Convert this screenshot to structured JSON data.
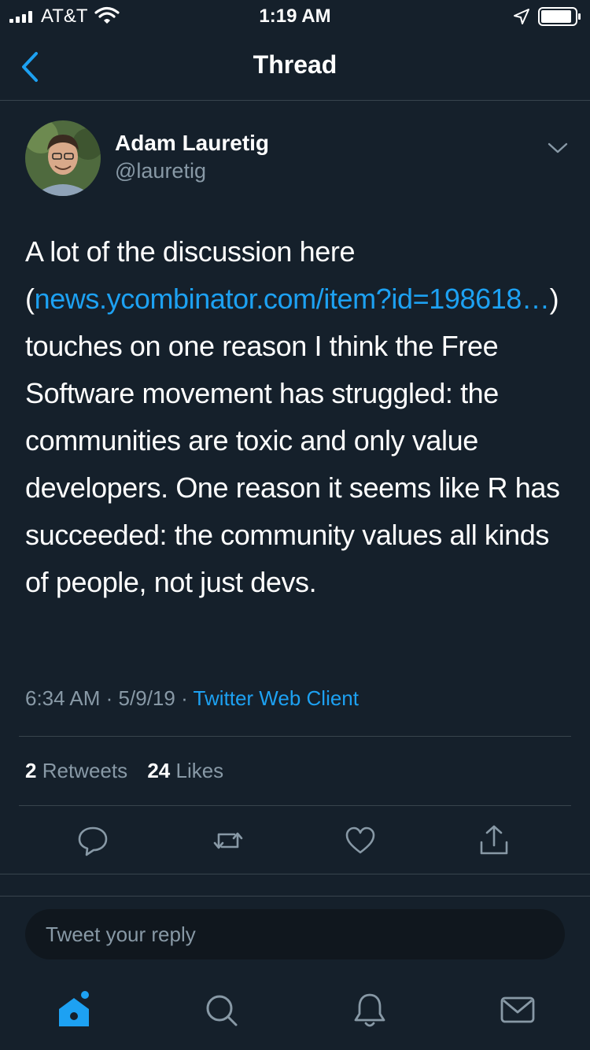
{
  "status_bar": {
    "carrier": "AT&T",
    "time": "1:19 AM"
  },
  "header": {
    "title": "Thread"
  },
  "tweet": {
    "author_name": "Adam Lauretig",
    "author_handle": "@lauretig",
    "text_before_link": "A lot of the discussion here (",
    "link_text": "news.ycombinator.com/item?id=198618…",
    "text_after_link": ") touches on one reason I think the Free Software movement has struggled: the communities are toxic and only value developers. One reason it seems like R has succeeded: the community values all kinds of people, not just devs.",
    "time": "6:34 AM",
    "date": "5/9/19",
    "separator": "·",
    "source": "Twitter Web Client",
    "retweet_count": "2",
    "retweets_label": "Retweets",
    "like_count": "24",
    "likes_label": "Likes"
  },
  "actions": [
    "reply-icon",
    "retweet-icon",
    "like-icon",
    "share-icon"
  ],
  "reply": {
    "placeholder": "Tweet your reply"
  },
  "tab_bar": [
    "home-icon",
    "search-icon",
    "notifications-icon",
    "messages-icon"
  ],
  "colors": {
    "background": "#15202b",
    "accent": "#1da1f2",
    "secondary_text": "#8899a6",
    "divider": "#38444d"
  }
}
